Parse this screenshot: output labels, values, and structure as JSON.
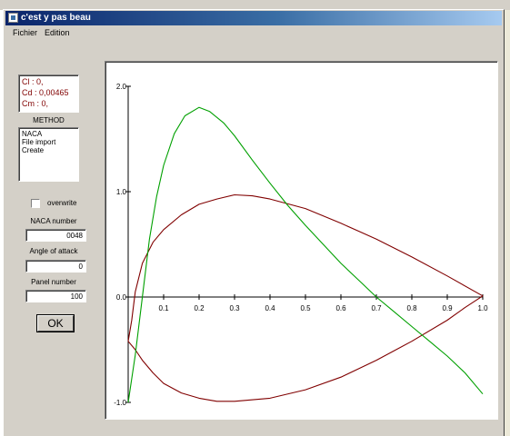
{
  "window": {
    "title": "c'est y pas beau"
  },
  "menu": {
    "items": [
      "Fichier",
      "Edition"
    ]
  },
  "coefficients": {
    "cl": "Cl : 0,",
    "cd": "Cd : 0,00465",
    "cm": "Cm : 0,"
  },
  "method": {
    "title": "METHOD",
    "options": [
      "NACA",
      "File import",
      "Create"
    ]
  },
  "overwrite": {
    "label": "overwrite",
    "checked": false
  },
  "naca": {
    "label": "NACA number",
    "value": "0048"
  },
  "attack": {
    "label": "Angle of attack",
    "value": "0"
  },
  "panel": {
    "label": "Panel number",
    "value": "100"
  },
  "ok_button": {
    "label": "OK"
  },
  "chart_data": {
    "type": "line",
    "xlim": [
      0,
      1
    ],
    "ylim": [
      -1,
      2
    ],
    "x_ticks": [
      "0.1",
      "0.2",
      "0.3",
      "0.4",
      "0.5",
      "0.6",
      "0.7",
      "0.8",
      "0.9",
      "1.0"
    ],
    "y_ticks": [
      "-1.0",
      "0.0",
      "1.0",
      "2.0"
    ],
    "grid": false,
    "series": [
      {
        "color": "#800000",
        "points": [
          [
            0.0,
            -0.42
          ],
          [
            0.01,
            -0.22
          ],
          [
            0.02,
            0.05
          ],
          [
            0.04,
            0.32
          ],
          [
            0.07,
            0.52
          ],
          [
            0.1,
            0.64
          ],
          [
            0.15,
            0.78
          ],
          [
            0.2,
            0.88
          ],
          [
            0.25,
            0.93
          ],
          [
            0.3,
            0.97
          ],
          [
            0.35,
            0.96
          ],
          [
            0.4,
            0.93
          ],
          [
            0.5,
            0.84
          ],
          [
            0.6,
            0.7
          ],
          [
            0.7,
            0.55
          ],
          [
            0.8,
            0.38
          ],
          [
            0.9,
            0.2
          ],
          [
            1.0,
            0.01
          ],
          [
            0.95,
            -0.1
          ],
          [
            0.9,
            -0.22
          ],
          [
            0.8,
            -0.42
          ],
          [
            0.7,
            -0.6
          ],
          [
            0.6,
            -0.76
          ],
          [
            0.5,
            -0.88
          ],
          [
            0.4,
            -0.96
          ],
          [
            0.3,
            -0.99
          ],
          [
            0.25,
            -0.99
          ],
          [
            0.2,
            -0.96
          ],
          [
            0.15,
            -0.91
          ],
          [
            0.1,
            -0.82
          ],
          [
            0.07,
            -0.72
          ],
          [
            0.04,
            -0.6
          ],
          [
            0.02,
            -0.5
          ],
          [
            0.0,
            -0.42
          ]
        ]
      },
      {
        "color": "#00a000",
        "points": [
          [
            0.0,
            -1.0
          ],
          [
            0.02,
            -0.55
          ],
          [
            0.04,
            0.0
          ],
          [
            0.06,
            0.55
          ],
          [
            0.08,
            0.95
          ],
          [
            0.1,
            1.25
          ],
          [
            0.13,
            1.55
          ],
          [
            0.16,
            1.72
          ],
          [
            0.2,
            1.8
          ],
          [
            0.23,
            1.76
          ],
          [
            0.27,
            1.65
          ],
          [
            0.3,
            1.53
          ],
          [
            0.35,
            1.3
          ],
          [
            0.4,
            1.08
          ],
          [
            0.45,
            0.87
          ],
          [
            0.5,
            0.68
          ],
          [
            0.55,
            0.5
          ],
          [
            0.6,
            0.32
          ],
          [
            0.65,
            0.16
          ],
          [
            0.7,
            0.0
          ],
          [
            0.75,
            -0.14
          ],
          [
            0.8,
            -0.28
          ],
          [
            0.85,
            -0.42
          ],
          [
            0.9,
            -0.56
          ],
          [
            0.95,
            -0.72
          ],
          [
            1.0,
            -0.92
          ]
        ]
      }
    ]
  }
}
